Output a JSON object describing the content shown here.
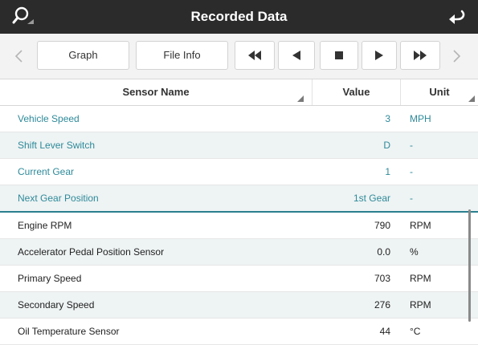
{
  "header": {
    "title": "Recorded Data",
    "search_icon": "magnifier-icon",
    "back_icon": "back-arrow-icon"
  },
  "toolbar": {
    "graph_label": "Graph",
    "file_info_label": "File Info",
    "controls": [
      "rewind-icon",
      "step-back-icon",
      "stop-icon",
      "play-icon",
      "fast-forward-icon"
    ]
  },
  "table": {
    "headers": {
      "name": "Sensor Name",
      "value": "Value",
      "unit": "Unit"
    },
    "selected_rows": [
      {
        "name": "Vehicle Speed",
        "value": "3",
        "unit": "MPH"
      },
      {
        "name": "Shift Lever Switch",
        "value": "D",
        "unit": "-"
      },
      {
        "name": "Current Gear",
        "value": "1",
        "unit": "-"
      },
      {
        "name": "Next Gear Position",
        "value": "1st Gear",
        "unit": "-"
      }
    ],
    "rows": [
      {
        "name": "Engine RPM",
        "value": "790",
        "unit": "RPM"
      },
      {
        "name": "Accelerator Pedal Position Sensor",
        "value": "0.0",
        "unit": "%"
      },
      {
        "name": "Primary Speed",
        "value": "703",
        "unit": "RPM"
      },
      {
        "name": "Secondary Speed",
        "value": "276",
        "unit": "RPM"
      },
      {
        "name": "Oil Temperature Sensor",
        "value": "44",
        "unit": "°C"
      }
    ]
  },
  "colors": {
    "header_bg": "#2b2b2b",
    "selected_text": "#2e8a9a",
    "alt_row_bg": "#eef3f3"
  }
}
